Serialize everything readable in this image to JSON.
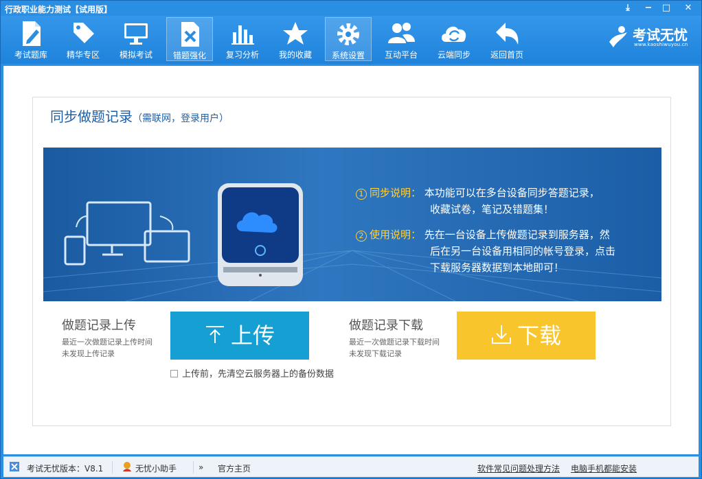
{
  "window": {
    "title": "行政职业能力测试【试用版】"
  },
  "toolbar": {
    "items": [
      {
        "label": "考试题库",
        "icon": "document-pen-icon",
        "active": false
      },
      {
        "label": "精华专区",
        "icon": "tag-icon",
        "active": false
      },
      {
        "label": "模拟考试",
        "icon": "monitor-icon",
        "active": false
      },
      {
        "label": "错题强化",
        "icon": "wrong-document-icon",
        "active": true
      },
      {
        "label": "复习分析",
        "icon": "bar-chart-icon",
        "active": false
      },
      {
        "label": "我的收藏",
        "icon": "star-icon",
        "active": false
      },
      {
        "label": "系统设置",
        "icon": "gear-icon",
        "active": true
      },
      {
        "label": "互动平台",
        "icon": "users-icon",
        "active": false
      },
      {
        "label": "云端同步",
        "icon": "cloud-sync-icon",
        "active": false
      },
      {
        "label": "返回首页",
        "icon": "back-arrow-icon",
        "active": false
      }
    ],
    "brand": {
      "name": "考试无忧",
      "url": "www.kaoshiwuyou.cn"
    }
  },
  "panel": {
    "title": "同步做题记录",
    "subtitle": "（需联网，登录用户）",
    "info": [
      {
        "num": "①",
        "tag": "同步说明：",
        "lines": [
          "本功能可以在多台设备同步答题记录，",
          "收藏试卷，笔记及错题集！"
        ]
      },
      {
        "num": "②",
        "tag": "使用说明：",
        "lines": [
          "先在一台设备上传做题记录到服务器，然",
          "后在另一台设备用相同的帐号登录，点击",
          "下载服务器数据到本地即可！"
        ]
      }
    ],
    "upload": {
      "title": "做题记录上传",
      "note1": "最近一次做题记录上传时间",
      "note2": "未发现上传记录",
      "button": "上传",
      "checkbox_label": "上传前，先清空云服务器上的备份数据"
    },
    "download": {
      "title": "做题记录下载",
      "note1": "最近一次做题记录下载时间",
      "note2": "未发现下载记录",
      "button": "下载"
    }
  },
  "statusbar": {
    "version": "考试无忧版本：V8.1",
    "assistant": "无忧小助手",
    "homepage": "官方主页",
    "faq": "软件常见问题处理方法",
    "mobile": "电脑手机都能安装"
  },
  "colors": {
    "accent": "#2a8ee3",
    "upload": "#169fd3",
    "download": "#f9c52c"
  }
}
